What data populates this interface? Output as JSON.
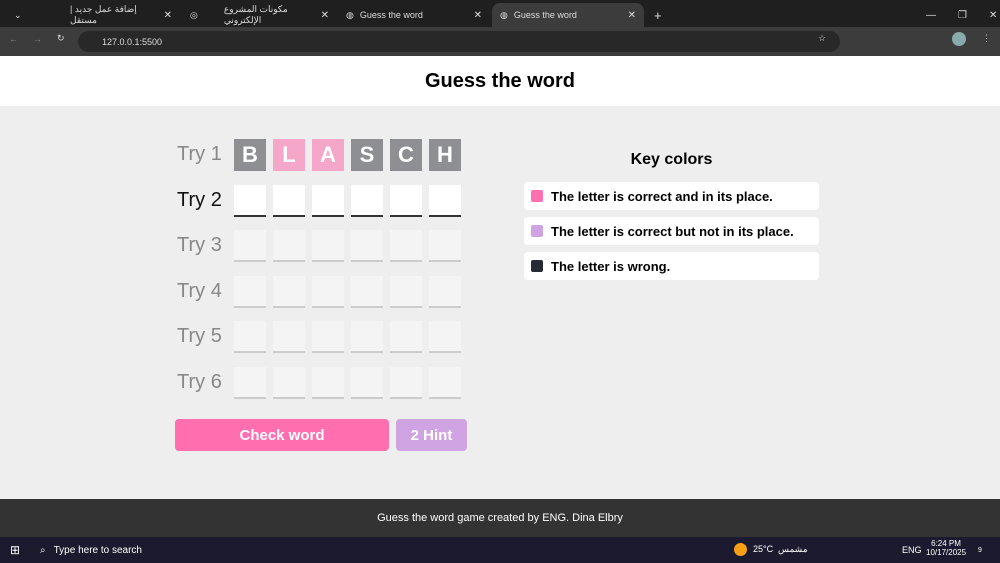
{
  "browser": {
    "tabs": [
      {
        "title": "إضافة عمل جديد | مستقل"
      },
      {
        "title": "مكونات المشروع الإلكتروني"
      },
      {
        "title": "Guess the word"
      },
      {
        "title": "Guess the word"
      }
    ],
    "url": "127.0.0.1:5500"
  },
  "page": {
    "title": "Guess the word",
    "tries": [
      {
        "label": "Try 1",
        "letters": [
          "B",
          "L",
          "A",
          "S",
          "C",
          "H"
        ],
        "states": [
          "wrong",
          "correct",
          "correct",
          "wrong",
          "wrong",
          "wrong"
        ]
      },
      {
        "label": "Try 2"
      },
      {
        "label": "Try 3"
      },
      {
        "label": "Try 4"
      },
      {
        "label": "Try 5"
      },
      {
        "label": "Try 6"
      }
    ],
    "check_label": "Check word",
    "hint_label": "2 Hint",
    "key": {
      "title": "Key colors",
      "items": [
        {
          "text": "The letter is correct and in its place.",
          "color": "#ff6fb0"
        },
        {
          "text": "The letter is correct but not in its place.",
          "color": "#d0a4e2"
        },
        {
          "text": "The letter is wrong.",
          "color": "#262a36"
        }
      ]
    },
    "footer": "Guess the word game created by ENG. Dina Elbry"
  },
  "taskbar": {
    "search": "Type here to search",
    "weather": "25°C",
    "weather_label": "مشمس",
    "lang": "ENG",
    "time": "6:24 PM",
    "date": "10/17/2025",
    "notif": "9"
  }
}
